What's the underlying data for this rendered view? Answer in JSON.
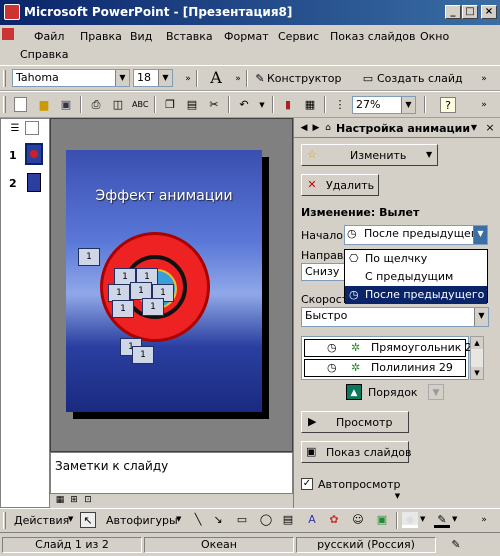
{
  "window": {
    "title": "Microsoft PowerPoint - [Презентация8]"
  },
  "menu": [
    "Файл",
    "Правка",
    "Вид",
    "Вставка",
    "Формат",
    "Сервис",
    "Показ слайдов",
    "Окно",
    "Справка"
  ],
  "format_toolbar": {
    "font": "Tahoma",
    "size": "18",
    "designer": "Конструктор",
    "new_slide": "Создать слайд"
  },
  "standard_toolbar": {
    "zoom": "27%"
  },
  "thumbnails": [
    {
      "num": "1"
    },
    {
      "num": "2"
    }
  ],
  "slide": {
    "title": "Эффект анимации",
    "tag_label": "1"
  },
  "notes": {
    "placeholder": "Заметки к слайду"
  },
  "task_pane": {
    "title": "Настройка анимации",
    "change_button": "Изменить",
    "delete_button": "Удалить",
    "effect_heading": "Изменение: Вылет",
    "start_label": "Начало:",
    "start_value": "После предыдущего",
    "start_options": [
      "По щелчку",
      "С предыдущим",
      "После предыдущего"
    ],
    "direction_label": "Направле",
    "direction_value": "Снизу",
    "speed_label": "Скорость",
    "speed_value": "Быстро",
    "animation_items": [
      "Прямоугольник 28",
      "Полилиния 29"
    ],
    "order_label": "Порядок",
    "preview_button": "Просмотр",
    "slideshow_button": "Показ слайдов",
    "autopreview_label": "Автопросмотр"
  },
  "draw_toolbar": {
    "actions": "Действия",
    "autoshapes": "Автофигуры"
  },
  "status": {
    "slide": "Слайд 1 из 2",
    "design": "Океан",
    "language": "русский (Россия)"
  },
  "colors": {
    "title_bar": "#0a246a",
    "selection": "#0a246a",
    "face": "#d4d0c8"
  }
}
